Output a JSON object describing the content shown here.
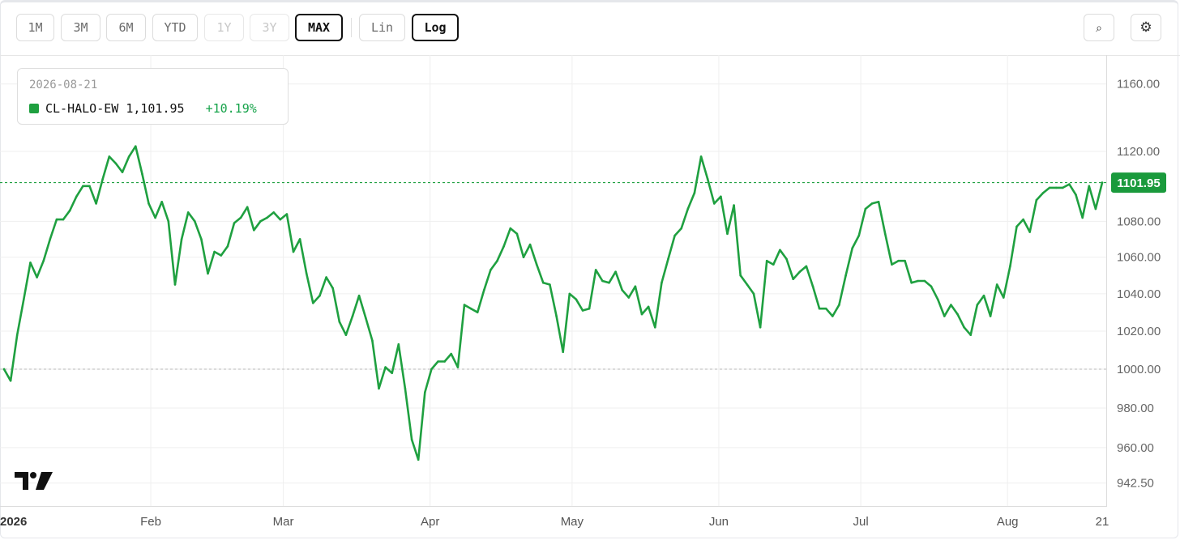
{
  "toolbar": {
    "ranges": [
      {
        "label": "1M",
        "state": "normal"
      },
      {
        "label": "3M",
        "state": "normal"
      },
      {
        "label": "6M",
        "state": "normal"
      },
      {
        "label": "YTD",
        "state": "normal"
      },
      {
        "label": "1Y",
        "state": "disabled"
      },
      {
        "label": "3Y",
        "state": "disabled"
      },
      {
        "label": "MAX",
        "state": "active"
      }
    ],
    "scales": [
      {
        "label": "Lin",
        "state": "normal"
      },
      {
        "label": "Log",
        "state": "active"
      }
    ],
    "search_icon": "search-icon",
    "search_glyph": "⌕",
    "settings_icon": "gear-icon",
    "settings_glyph": "⚙"
  },
  "legend": {
    "date": "2026-08-21",
    "symbol": "CL-HALO-EW",
    "value": "1,101.95",
    "change": "+10.19%",
    "swatch_color": "#1fa040",
    "change_color": "#16a34a"
  },
  "price_label": "1101.95",
  "colors": {
    "line": "#1fa040",
    "price_label_bg": "#1a9a3c",
    "baseline": "#c8c8c8",
    "grid": "#efefef"
  },
  "chart_data": {
    "type": "line",
    "scale": "log",
    "series": [
      {
        "name": "CL-HALO-EW",
        "values": [
          1000.0,
          994.0,
          1018.0,
          1037.0,
          1057.0,
          1049.0,
          1058.0,
          1070.0,
          1081.0,
          1081.0,
          1086.0,
          1094.0,
          1100.0,
          1100.0,
          1090.0,
          1104.0,
          1117.0,
          1113.0,
          1108.0,
          1117.0,
          1123.0,
          1107.0,
          1090.0,
          1082.0,
          1091.0,
          1080.0,
          1045.0,
          1070.0,
          1085.0,
          1080.0,
          1070.0,
          1051.0,
          1063.0,
          1061.0,
          1066.0,
          1079.0,
          1082.0,
          1088.0,
          1075.0,
          1080.0,
          1082.0,
          1085.0,
          1081.0,
          1084.0,
          1063.0,
          1070.0,
          1051.0,
          1035.0,
          1039.0,
          1049.0,
          1043.0,
          1025.0,
          1018.0,
          1028.0,
          1039.0,
          1027.0,
          1015.0,
          990.0,
          1001.0,
          998.0,
          1013.0,
          990.0,
          964.0,
          954.0,
          988.0,
          1000.0,
          1004.0,
          1004.0,
          1008.0,
          1001.0,
          1034.0,
          1032.0,
          1030.0,
          1042.0,
          1053.0,
          1058.0,
          1066.0,
          1076.0,
          1073.0,
          1060.0,
          1067.0,
          1056.0,
          1046.0,
          1045.0,
          1028.0,
          1009.0,
          1040.0,
          1037.0,
          1031.0,
          1032.0,
          1053.0,
          1047.0,
          1046.0,
          1052.0,
          1042.0,
          1038.0,
          1044.0,
          1029.0,
          1033.0,
          1022.0,
          1046.0,
          1059.0,
          1072.0,
          1076.0,
          1087.0,
          1096.0,
          1117.0,
          1104.0,
          1090.0,
          1094.0,
          1073.0,
          1089.0,
          1050.0,
          1045.0,
          1040.0,
          1022.0,
          1058.0,
          1056.0,
          1064.0,
          1059.0,
          1048.0,
          1052.0,
          1055.0,
          1044.0,
          1032.0,
          1032.0,
          1028.0,
          1034.0,
          1050.0,
          1065.0,
          1072.0,
          1087.0,
          1090.0,
          1091.0,
          1073.0,
          1056.0,
          1058.0,
          1058.0,
          1046.0,
          1047.0,
          1047.0,
          1044.0,
          1037.0,
          1028.0,
          1034.0,
          1029.0,
          1022.0,
          1018.0,
          1034.0,
          1039.0,
          1028.0,
          1045.0,
          1038.0,
          1055.0,
          1077.0,
          1081.0,
          1074.0,
          1092.0,
          1096.0,
          1099.0,
          1099.0,
          1099.0,
          1101.0,
          1095.0,
          1082.0,
          1100.0,
          1087.0,
          1101.95
        ]
      }
    ],
    "x_start": "2026-01-01",
    "x_end": "2026-08-21",
    "x_ticks": [
      {
        "label": "2026",
        "date": "2026-01-01",
        "bold": true
      },
      {
        "label": "Feb",
        "date": "2026-02-01",
        "bold": false
      },
      {
        "label": "Mar",
        "date": "2026-03-01",
        "bold": false
      },
      {
        "label": "Apr",
        "date": "2026-04-01",
        "bold": false
      },
      {
        "label": "May",
        "date": "2026-05-01",
        "bold": false
      },
      {
        "label": "Jun",
        "date": "2026-06-01",
        "bold": false
      },
      {
        "label": "Jul",
        "date": "2026-07-01",
        "bold": false
      },
      {
        "label": "Aug",
        "date": "2026-08-01",
        "bold": false
      },
      {
        "label": "21",
        "date": "2026-08-21",
        "bold": false
      }
    ],
    "y_ticks": [
      {
        "label": "1160.00",
        "value": 1160
      },
      {
        "label": "1120.00",
        "value": 1120
      },
      {
        "label": "1080.00",
        "value": 1080
      },
      {
        "label": "1060.00",
        "value": 1060
      },
      {
        "label": "1040.00",
        "value": 1040
      },
      {
        "label": "1020.00",
        "value": 1020
      },
      {
        "label": "1000.00",
        "value": 1000
      },
      {
        "label": "980.00",
        "value": 980
      },
      {
        "label": "960.00",
        "value": 960
      },
      {
        "label": "942.50",
        "value": 942.5
      }
    ],
    "baseline": 1000,
    "last_value": 1101.95,
    "grid": true
  }
}
